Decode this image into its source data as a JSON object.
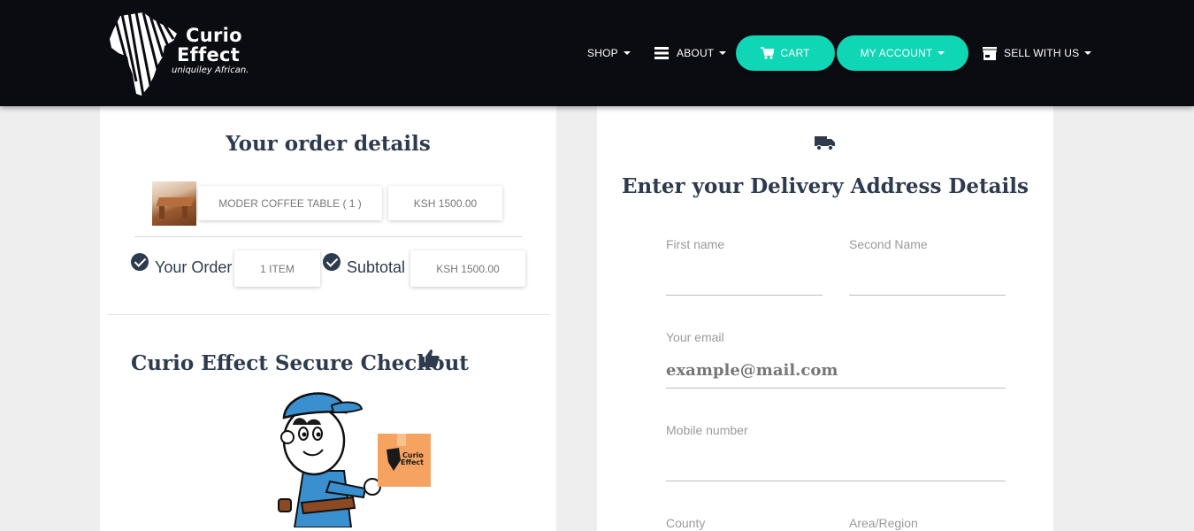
{
  "brand": {
    "line1": "Curio",
    "line2": "Effect",
    "tagline": "uniquiley African."
  },
  "nav": {
    "shop": "SHOP",
    "about": "ABOUT",
    "cart": "CART",
    "account": "MY ACCOUNT",
    "sell": "SELL WITH US",
    "accent": "#0fd6b4"
  },
  "order": {
    "title": "Your order details",
    "item_name": "MODER COFFEE TABLE ( 1 )",
    "item_price": "KSH 1500.00",
    "your_order_label": "Your Order",
    "items_count": "1 ITEM",
    "subtotal_label": "Subtotal",
    "subtotal_value": "KSH 1500.00"
  },
  "secure": {
    "title": "Curio Effect Secure Checkout",
    "box_line1": "Curio",
    "box_line2": "Effect"
  },
  "delivery": {
    "title": "Enter your Delivery Address Details",
    "first_name_label": "First name",
    "second_name_label": "Second Name",
    "email_label": "Your email",
    "email_placeholder": "example@mail.com",
    "mobile_label": "Mobile number",
    "county_label": "County",
    "area_label": "Area/Region"
  }
}
